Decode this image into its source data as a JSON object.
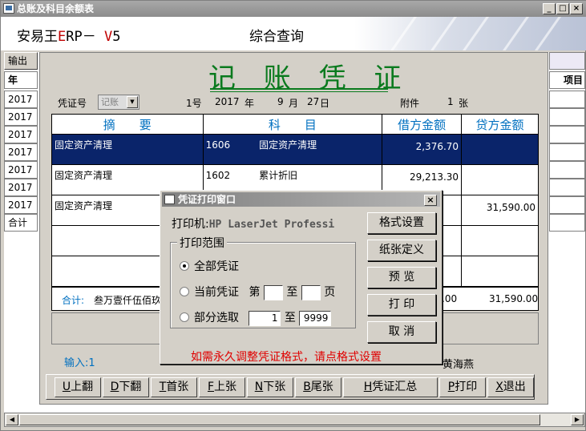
{
  "window": {
    "title": "总账及科目余额表"
  },
  "header": {
    "brand_prefix": "安易王",
    "brand_e": "E",
    "brand_mid": "RP－ ",
    "brand_v": "V",
    "brand_num": "5",
    "mode": "综合查询"
  },
  "background": {
    "output_label": "输出",
    "year_header": "年",
    "years": [
      "2017",
      "2017",
      "2017",
      "2017",
      "2017",
      "2017",
      "2017"
    ],
    "total_label": "合计",
    "right_header": "项目"
  },
  "voucher": {
    "title": "记 账 凭 证",
    "no_label": "凭证号",
    "type_value": "记账",
    "number": "1号",
    "year": "2017",
    "year_label": "年",
    "month": "9",
    "month_label": "月",
    "day": "27",
    "day_label": "日",
    "attach_label": "附件",
    "attach_count": "1",
    "attach_unit": "张",
    "columns": [
      "摘　　要",
      "科　　目",
      "借方金额",
      "贷方金额"
    ],
    "rows": [
      {
        "summary": "固定资产清理",
        "code": "1606",
        "account": "固定资产清理",
        "debit": "2,376.70",
        "credit": ""
      },
      {
        "summary": "固定资产清理",
        "code": "1602",
        "account": "累计折旧",
        "debit": "29,213.30",
        "credit": ""
      },
      {
        "summary": "固定资产清理",
        "code": "",
        "account": "",
        "debit": "",
        "credit": "31,590.00"
      }
    ],
    "total_label": "合计:",
    "total_words": "叁万壹仟伍佰玖",
    "total_debit": ".00",
    "total_credit": "31,590.00",
    "input_label": "输入:1",
    "maker_name": "黄海燕"
  },
  "navbar": {
    "buttons": [
      {
        "key": "U",
        "label": "上翻"
      },
      {
        "key": "D",
        "label": "下翻"
      },
      {
        "key": "T",
        "label": "首张"
      },
      {
        "key": "F",
        "label": "上张"
      },
      {
        "key": "N",
        "label": "下张"
      },
      {
        "key": "B",
        "label": "尾张"
      },
      {
        "key": "H",
        "label": "凭证汇总"
      },
      {
        "key": "P",
        "label": "打印"
      },
      {
        "key": "X",
        "label": "退出"
      }
    ]
  },
  "dialog": {
    "title": "凭证打印窗口",
    "printer_label": "打印机:",
    "printer_name": "HP LaserJet Professi",
    "range_label": "打印范围",
    "opt_all": "全部凭证",
    "opt_current": "当前凭证",
    "page_prefix": "第",
    "to_label": "至",
    "page_suffix": "页",
    "opt_partial": "部分选取",
    "from_value": "1",
    "to_value": "9999",
    "btn_format": "格式设置",
    "btn_paper": "纸张定义",
    "btn_preview": "预  览",
    "btn_print": "打  印",
    "btn_cancel": "取  消",
    "note": "如需永久调整凭证格式，请点格式设置"
  },
  "colors": {
    "accent": "#0070c0",
    "title_green": "#0a7a1e",
    "selection": "#0a246a",
    "warning": "#e00000"
  }
}
